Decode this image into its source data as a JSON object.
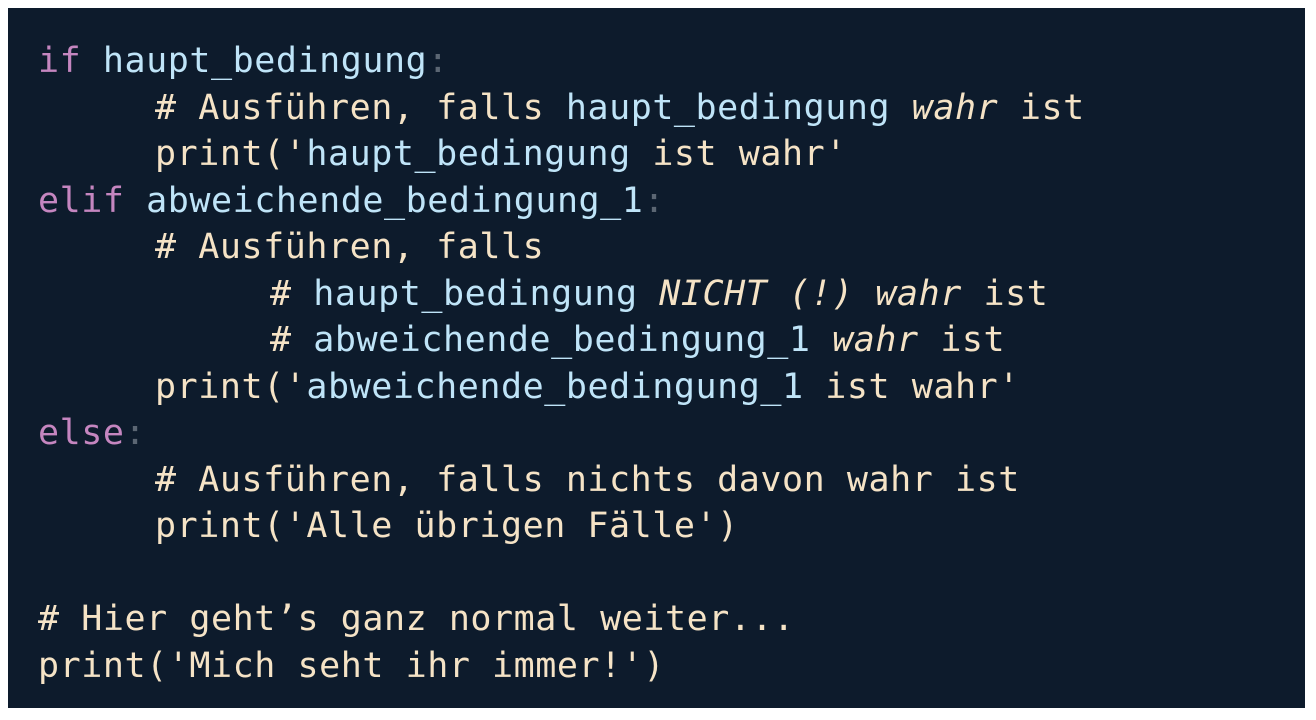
{
  "code": {
    "line1": {
      "kw": "if",
      "name": "haupt_bedingung",
      "colon": ":"
    },
    "line2": {
      "hash": "# Ausführen, falls ",
      "var": "haupt_bedingung",
      "italic": "wahr",
      "rest": "ist"
    },
    "line3": {
      "func": "print('",
      "var": "haupt_bedingung",
      "rest": "ist wahr'"
    },
    "line4": {
      "kw": "elif",
      "name": "abweichende_bedingung_1",
      "colon": ":"
    },
    "line5": {
      "text": "# Ausführen, falls"
    },
    "line6": {
      "hash": "# ",
      "var": "haupt_bedingung",
      "italic": "NICHT (!) wahr",
      "rest": "ist"
    },
    "line7": {
      "hash": "# ",
      "var": "abweichende_bedingung_1",
      "italic": "wahr",
      "rest": "ist"
    },
    "line8": {
      "func": "print('",
      "var": "abweichende_bedingung_1",
      "rest": "ist wahr'"
    },
    "line9": {
      "kw": "else",
      "colon": ":"
    },
    "line10": {
      "text": "# Ausführen, falls nichts davon wahr ist"
    },
    "line11": {
      "text": "print('Alle übrigen Fälle')"
    },
    "line13": {
      "text": "# Hier geht’s ganz normal weiter..."
    },
    "line14": {
      "text": "print('Mich seht ihr immer!')"
    }
  }
}
